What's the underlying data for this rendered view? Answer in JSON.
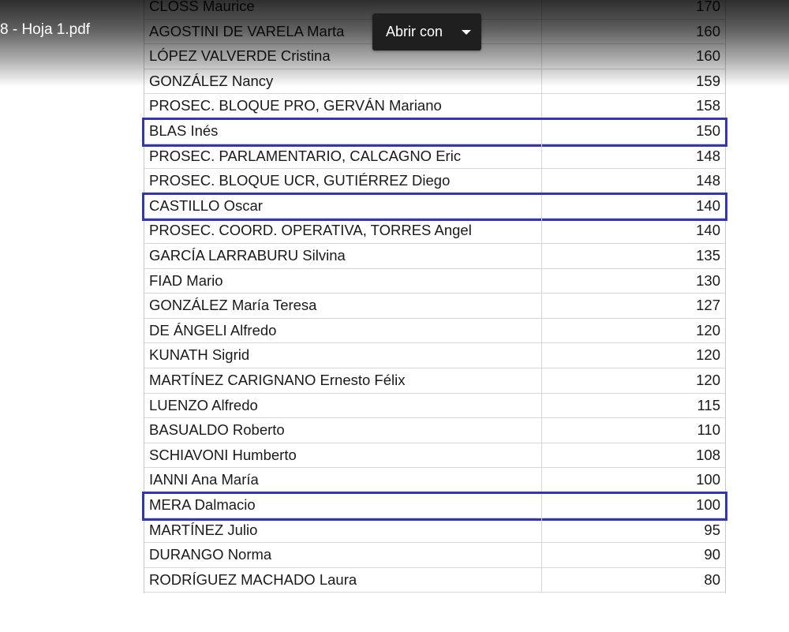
{
  "viewer": {
    "filename": "8 - Hoja 1.pdf",
    "open_with_label": "Abrir con",
    "open_with_icon": "caret-down-icon"
  },
  "highlight_color": "#3236b5",
  "table": {
    "rows": [
      {
        "name": "CLOSS Maurice",
        "value": "170",
        "highlighted": false
      },
      {
        "name": "AGOSTINI DE VARELA Marta",
        "value": "160",
        "highlighted": false
      },
      {
        "name": "LÓPEZ VALVERDE Cristina",
        "value": "160",
        "highlighted": false
      },
      {
        "name": "GONZÁLEZ Nancy",
        "value": "159",
        "highlighted": false
      },
      {
        "name": "PROSEC. BLOQUE PRO, GERVÁN Mariano",
        "value": "158",
        "highlighted": false
      },
      {
        "name": "BLAS Inés",
        "value": "150",
        "highlighted": true
      },
      {
        "name": "PROSEC. PARLAMENTARIO, CALCAGNO Eric",
        "value": "148",
        "highlighted": false
      },
      {
        "name": "PROSEC. BLOQUE UCR, GUTIÉRREZ Diego",
        "value": "148",
        "highlighted": false
      },
      {
        "name": "CASTILLO Oscar",
        "value": "140",
        "highlighted": true
      },
      {
        "name": "PROSEC. COORD. OPERATIVA, TORRES Angel",
        "value": "140",
        "highlighted": false
      },
      {
        "name": "GARCÍA LARRABURU Silvina",
        "value": "135",
        "highlighted": false
      },
      {
        "name": "FIAD Mario",
        "value": "130",
        "highlighted": false
      },
      {
        "name": "GONZÁLEZ María Teresa",
        "value": "127",
        "highlighted": false
      },
      {
        "name": "DE ÁNGELI Alfredo",
        "value": "120",
        "highlighted": false
      },
      {
        "name": "KUNATH Sigrid",
        "value": "120",
        "highlighted": false
      },
      {
        "name": "MARTÍNEZ CARIGNANO Ernesto Félix",
        "value": "120",
        "highlighted": false
      },
      {
        "name": "LUENZO Alfredo",
        "value": "115",
        "highlighted": false
      },
      {
        "name": "BASUALDO Roberto",
        "value": "110",
        "highlighted": false
      },
      {
        "name": "SCHIAVONI Humberto",
        "value": "108",
        "highlighted": false
      },
      {
        "name": "IANNI Ana María",
        "value": "100",
        "highlighted": false
      },
      {
        "name": "MERA Dalmacio",
        "value": "100",
        "highlighted": true
      },
      {
        "name": "MARTÍNEZ Julio",
        "value": "95",
        "highlighted": false
      },
      {
        "name": "DURANGO Norma",
        "value": "90",
        "highlighted": false
      },
      {
        "name": "RODRÍGUEZ MACHADO Laura",
        "value": "80",
        "highlighted": false
      }
    ]
  }
}
